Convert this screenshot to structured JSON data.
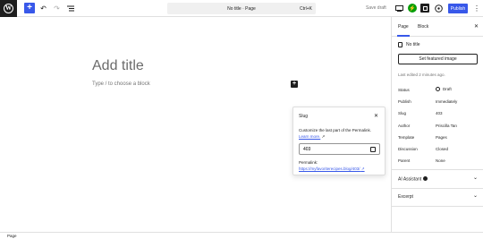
{
  "topbar": {
    "add_label": "+",
    "undo_glyph": "↶",
    "redo_glyph": "↷",
    "document_title": "No title · Page",
    "shortcut": "Ctrl+K",
    "save_draft": "Save draft",
    "publish": "Publish",
    "more_glyph": "⋮"
  },
  "editor": {
    "title_placeholder": "Add title",
    "block_hint": "Type / to choose a block",
    "inline_add": "+"
  },
  "slug_popover": {
    "title": "Slug",
    "close": "✕",
    "description": "Customize the last part of the Permalink.",
    "learn_more": "Learn more.",
    "slug_value": "403",
    "permalink_label": "Permalink:",
    "permalink_url": "https://myfavoriterecipes.blog/403/"
  },
  "sidebar": {
    "tabs": [
      {
        "label": "Page"
      },
      {
        "label": "Block"
      }
    ],
    "close": "✕",
    "page_title": "No title",
    "featured_image_button": "Set featured image",
    "last_edited": "Last edited 2 minutes ago.",
    "meta": [
      {
        "label": "Status",
        "value": "Draft"
      },
      {
        "label": "Publish",
        "value": "Immediately"
      },
      {
        "label": "Slug",
        "value": "403"
      },
      {
        "label": "Author",
        "value": "Priscilla Tan"
      },
      {
        "label": "Template",
        "value": "Pages"
      },
      {
        "label": "Discussion",
        "value": "Closed"
      },
      {
        "label": "Parent",
        "value": "None"
      }
    ],
    "panels": [
      {
        "title": "AI Assistant"
      },
      {
        "title": "Excerpt"
      }
    ]
  },
  "footer": {
    "breadcrumb": "Page"
  },
  "colors": {
    "accent": "#3858e9",
    "dark": "#1e1e1e",
    "jetpack": "#069e08"
  }
}
